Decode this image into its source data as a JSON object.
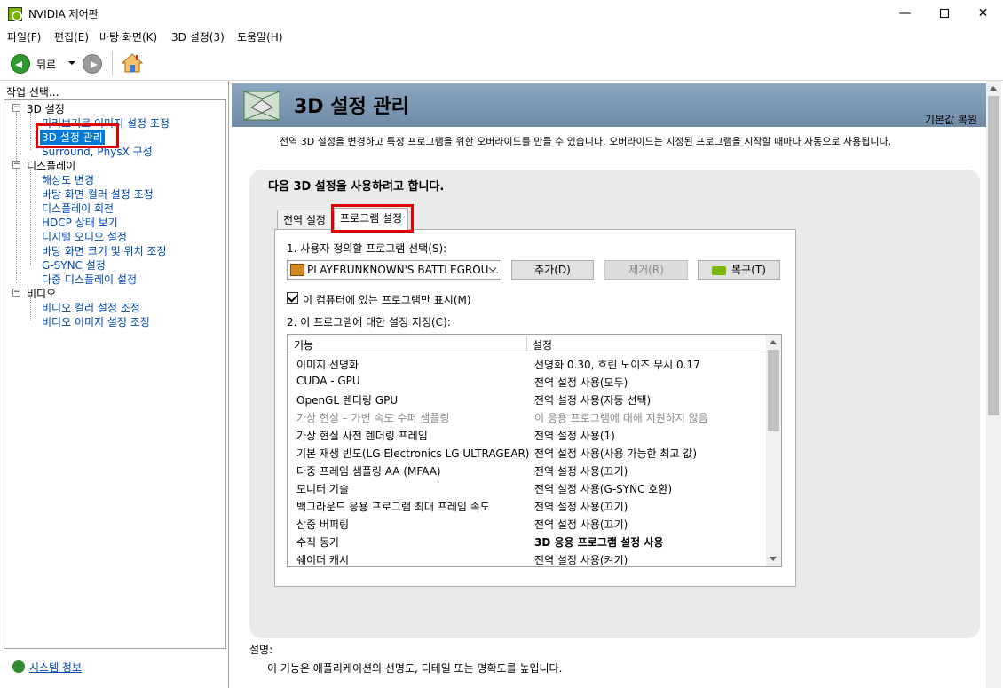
{
  "window": {
    "title": "NVIDIA 제어판",
    "minimize": "—",
    "close": "✕"
  },
  "menu": [
    "파일(F)",
    "편집(E)",
    "바탕 화면(K)",
    "3D 설정(3)",
    "도움말(H)"
  ],
  "toolbar": {
    "back_label": "뒤로"
  },
  "left_panel": {
    "task_label": "작업 선택...",
    "tree": [
      {
        "label": "3D 설정",
        "level": 0,
        "toggle": "−"
      },
      {
        "label": "미리보기로 이미지 설정 조정",
        "level": 1
      },
      {
        "label": "3D 설정 관리",
        "level": 1,
        "selected": true
      },
      {
        "label": "Surround, PhysX 구성",
        "level": 1
      },
      {
        "label": "디스플레이",
        "level": 0,
        "toggle": "−"
      },
      {
        "label": "해상도 변경",
        "level": 1
      },
      {
        "label": "바탕 화면 컬러 설정 조정",
        "level": 1
      },
      {
        "label": "디스플레이 회전",
        "level": 1
      },
      {
        "label": "HDCP 상태 보기",
        "level": 1
      },
      {
        "label": "디지털 오디오 설정",
        "level": 1
      },
      {
        "label": "바탕 화면 크기 및 위치 조정",
        "level": 1
      },
      {
        "label": "G-SYNC 설정",
        "level": 1
      },
      {
        "label": "다중 디스플레이 설정",
        "level": 1
      },
      {
        "label": "비디오",
        "level": 0,
        "toggle": "−"
      },
      {
        "label": "비디오 컬러 설정 조정",
        "level": 1
      },
      {
        "label": "비디오 이미지 설정 조정",
        "level": 1
      }
    ],
    "system_info": "시스템 정보"
  },
  "main": {
    "title": "3D 설정 관리",
    "restore_link": "기본값 복원",
    "description": "전역 3D 설정을 변경하고 특정 프로그램을 위한 오버라이드를 만들 수 있습니다. 오버라이드는 지정된 프로그램을 시작할 때마다 자동으로 사용됩니다.",
    "panel_heading": "다음 3D 설정을 사용하려고 합니다.",
    "tabs": [
      "전역 설정",
      "프로그램 설정"
    ],
    "step1_label": "1. 사용자 정의할 프로그램 선택(S):",
    "program_selected": "PLAYERUNKNOWN'S BATTLEGROU...",
    "add_button": "추가(D)",
    "remove_button": "제거(R)",
    "restore_button": "복구(T)",
    "checkbox_label": "이 컴퓨터에 있는 프로그램만 표시(M)",
    "step2_label": "2. 이 프로그램에 대한 설정 지정(C):",
    "columns": [
      "기능",
      "설정"
    ],
    "rows": [
      {
        "feature": "이미지 선명화",
        "setting": "선명화 0.30, 흐린 노이즈 무시 0.17"
      },
      {
        "feature": "CUDA - GPU",
        "setting": "전역 설정 사용(모두)"
      },
      {
        "feature": "OpenGL 렌더링 GPU",
        "setting": "전역 설정 사용(자동 선택)"
      },
      {
        "feature": "가상 현실 – 가변 속도 수퍼 샘플링",
        "setting": "이 응용 프로그램에 대해 지원하지 않음",
        "muted": true
      },
      {
        "feature": "가상 현실 사전 렌더링 프레임",
        "setting": "전역 설정 사용(1)"
      },
      {
        "feature": "기본 재생 빈도(LG Electronics LG ULTRAGEAR)",
        "setting": "전역 설정 사용(사용 가능한 최고 값)"
      },
      {
        "feature": "다중 프레임 샘플링 AA (MFAA)",
        "setting": "전역 설정 사용(끄기)"
      },
      {
        "feature": "모니터 기술",
        "setting": "전역 설정 사용(G-SYNC 호환)"
      },
      {
        "feature": "백그라운드 응용 프로그램 최대 프레임 속도",
        "setting": "전역 설정 사용(끄기)"
      },
      {
        "feature": "삼중 버퍼링",
        "setting": "전역 설정 사용(끄기)"
      },
      {
        "feature": "수직 동기",
        "setting": "3D 응용 프로그램 설정 사용",
        "bold": true
      },
      {
        "feature": "쉐이더 캐시",
        "setting": "전역 설정 사용(켜기)"
      }
    ],
    "desc_label": "설명:",
    "desc_text": "이 기능은 애플리케이션의 선명도, 디테일 또는 명확도를 높입니다."
  },
  "colors": {
    "nvidia_green": "#76b900",
    "highlight_red": "#e00000",
    "selection_blue": "#0078d7",
    "link_blue": "#0047b3"
  }
}
